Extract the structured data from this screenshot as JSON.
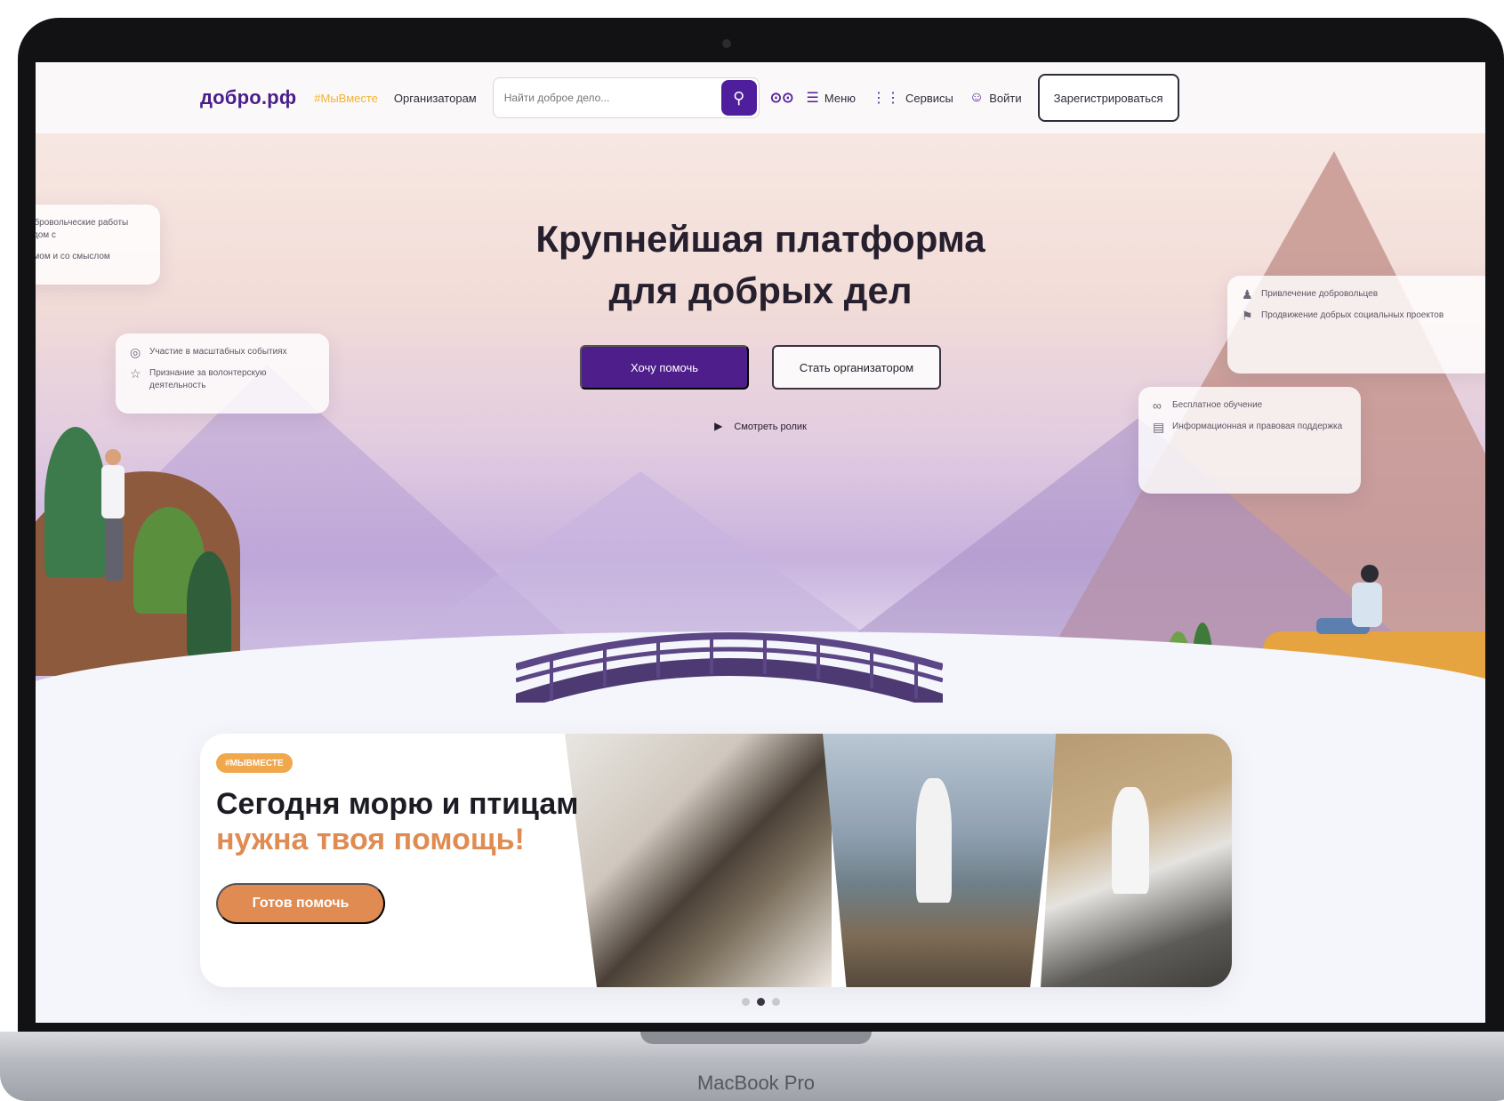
{
  "device": {
    "model_label": "MacBook Pro"
  },
  "header": {
    "logo": "добро.рф",
    "hashtag": "#МыВместе",
    "organizers_link": "Организаторам",
    "search_placeholder": "Найти доброе дело...",
    "accessibility_icon": "glasses-icon",
    "menu_label": "Меню",
    "services_label": "Сервисы",
    "login_label": "Войти",
    "register_label": "Зарегистрироваться"
  },
  "hero": {
    "title_line1": "Крупнейшая платформа",
    "title_line2": "для добрых дел",
    "help_button": "Хочу помочь",
    "organizer_button": "Стать организатором",
    "watch_video": "Смотреть ролик",
    "bubble_left_top": [
      "Добровольческие работы рядом с",
      "домом и со смыслом"
    ],
    "bubble_left": [
      "Участие в масштабных событиях",
      "Признание за волонтерскую деятельность"
    ],
    "bubble_right_top": [
      "Привлечение добровольцев",
      "Продвижение добрых социальных проектов"
    ],
    "bubble_right": [
      "Бесплатное обучение",
      "Информационная и правовая поддержка"
    ]
  },
  "promo": {
    "tag": "#МЫВМЕСТЕ",
    "title": "Сегодня морю и птицам",
    "subtitle": "нужна твоя помощь!",
    "button": "Готов помочь"
  },
  "carousel": {
    "slide_count": 3,
    "active_index": 1
  },
  "colors": {
    "brand_purple": "#4e1e8a",
    "accent_orange": "#e08b52",
    "hashtag_yellow": "#f2b431"
  }
}
